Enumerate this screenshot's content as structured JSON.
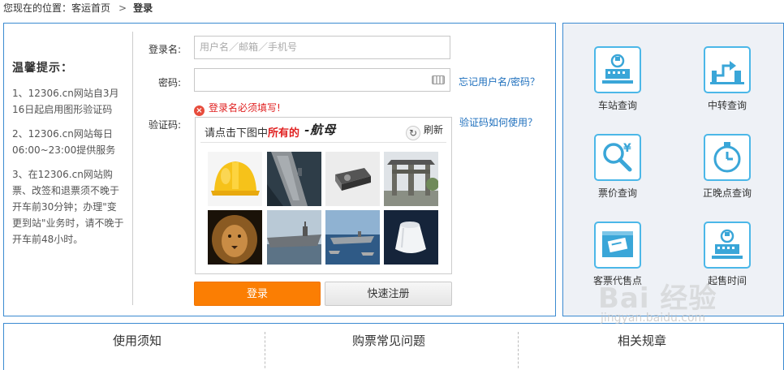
{
  "breadcrumb": {
    "prefix": "您现在的位置：",
    "home": "客运首页",
    "separator": ">",
    "current": "登录"
  },
  "tips": {
    "title": "温馨提示：",
    "items": [
      "1、12306.cn网站自3月16日起启用图形验证码",
      "2、12306.cn网站每日06:00~23:00提供服务",
      "3、在12306.cn网站购票、改签和退票须不晚于开车前30分钟；办理\"变更到站\"业务时，请不晚于开车前48小时。"
    ]
  },
  "form": {
    "username_label": "登录名:",
    "username_placeholder": "用户名／邮箱／手机号",
    "password_label": "密码:",
    "password_value": "",
    "forgot_link": "忘记用户名/密码？",
    "error_text": "登录名必须填写!",
    "captcha_label": "验证码:",
    "captcha_help_link": "验证码如何使用？",
    "login_button": "登录",
    "register_button": "快速注册"
  },
  "captcha": {
    "prompt_prefix": "请点击下图中",
    "prompt_emphasis": "所有的",
    "target_word": "-航母",
    "refresh_label": "刷新",
    "tiles": [
      "safety-helmet",
      "aircraft-carrier-aerial",
      "projector",
      "stone-archway",
      "lion",
      "aircraft-carrier-side",
      "aircraft-carrier-fleet",
      "white-lampshade"
    ]
  },
  "quick_links": [
    {
      "label": "车站查询",
      "icon": "station-icon"
    },
    {
      "label": "中转查询",
      "icon": "transfer-icon"
    },
    {
      "label": "票价查询",
      "icon": "ticket-price-icon"
    },
    {
      "label": "正晚点查询",
      "icon": "timer-icon"
    },
    {
      "label": "客票代售点",
      "icon": "ticket-agency-icon"
    },
    {
      "label": "起售时间",
      "icon": "sale-time-icon"
    }
  ],
  "bottom_tabs": [
    "使用须知",
    "购票常见问题",
    "相关规章"
  ],
  "watermark": {
    "logo": "Bai 经验",
    "url": "jingyan.baidu.com"
  },
  "colors": {
    "border_blue": "#3b8ad1",
    "login_orange": "#fb7e03",
    "icon_blue": "#4bb7e8",
    "error_red": "#e02020",
    "link_blue": "#1e6fbd"
  }
}
